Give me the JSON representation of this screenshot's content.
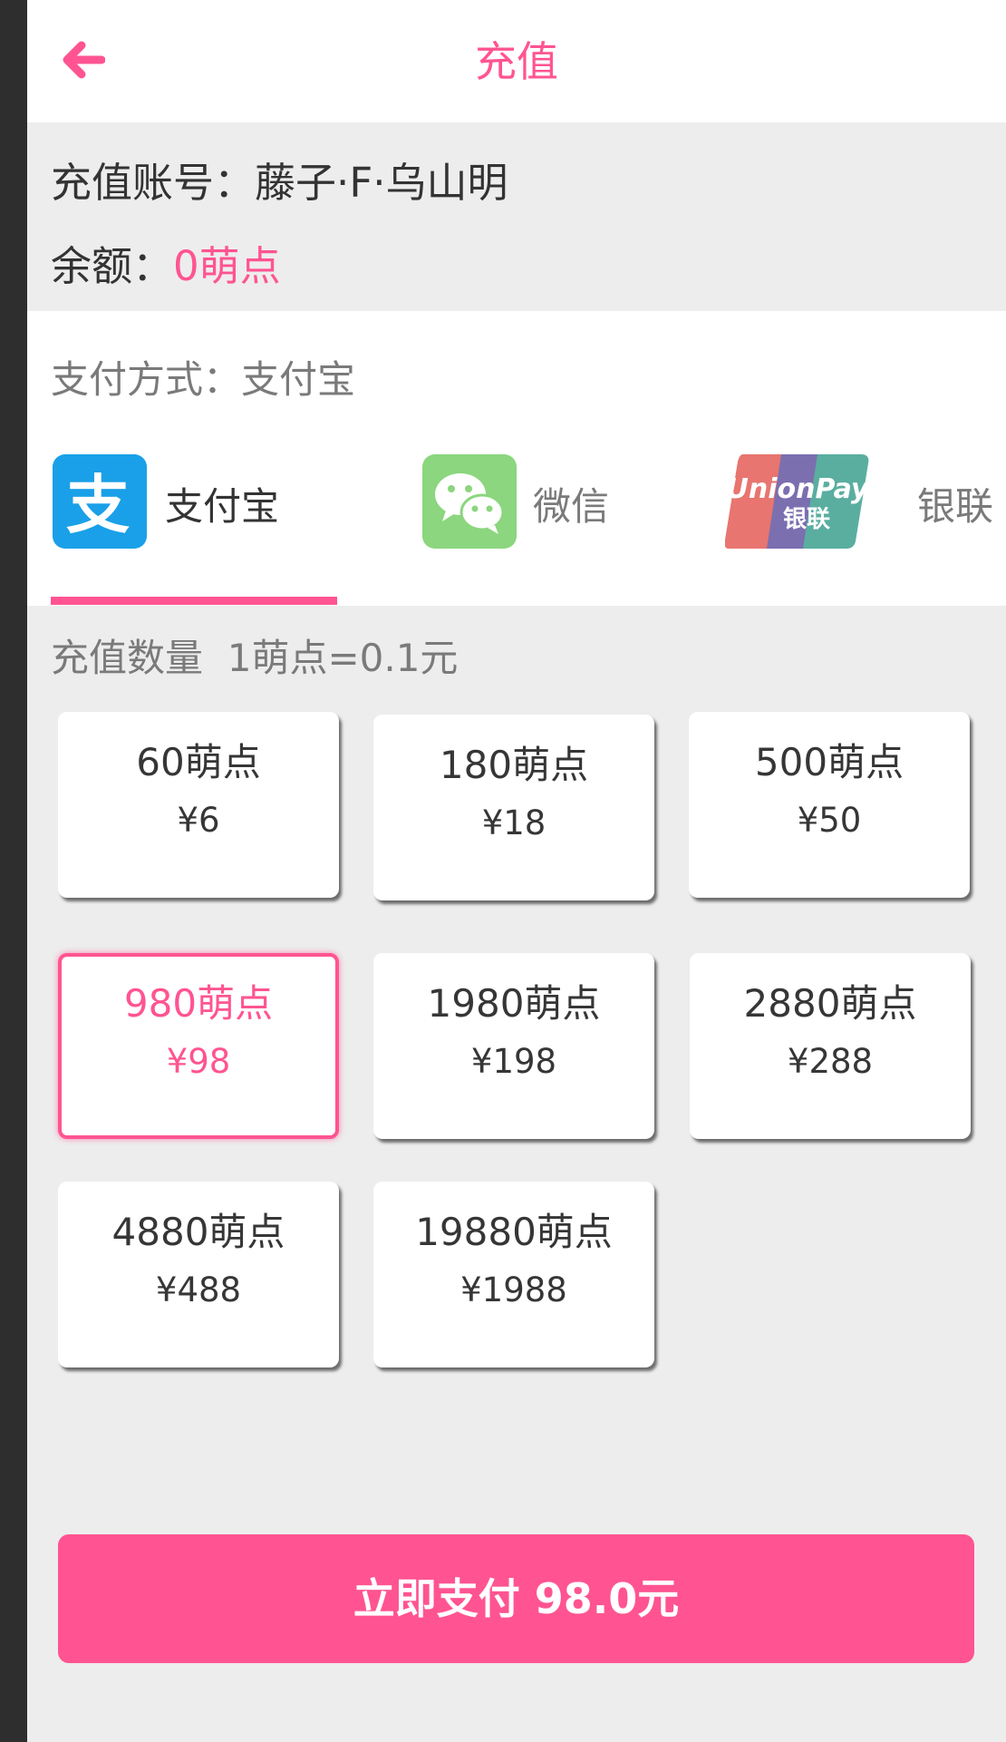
{
  "header": {
    "title": "充值",
    "back_icon": "arrow-left-icon",
    "accent_color": "#ff5491"
  },
  "account": {
    "label": "充值账号：",
    "name": "藤子·F·乌山明",
    "balance_label": "余额：",
    "balance_value": "0萌点"
  },
  "payment": {
    "label": "支付方式：",
    "selected": "支付宝",
    "options": [
      {
        "icon": "alipay-icon",
        "label": "支付宝"
      },
      {
        "icon": "wechat-icon",
        "label": "微信"
      },
      {
        "icon": "unionpay-icon",
        "label": "银联"
      }
    ]
  },
  "recharge": {
    "label": "充值数量",
    "rate": "1萌点=0.1元",
    "packages": [
      {
        "points": "60萌点",
        "price": "¥6"
      },
      {
        "points": "180萌点",
        "price": "¥18"
      },
      {
        "points": "500萌点",
        "price": "¥50"
      },
      {
        "points": "980萌点",
        "price": "¥98",
        "selected": true
      },
      {
        "points": "1980萌点",
        "price": "¥198"
      },
      {
        "points": "2880萌点",
        "price": "¥288"
      },
      {
        "points": "4880萌点",
        "price": "¥488"
      },
      {
        "points": "19880萌点",
        "price": "¥1988"
      }
    ]
  },
  "pay_button": {
    "label": "立即支付 98.0元"
  },
  "colors": {
    "primary_text": "#333333",
    "secondary_text": "#7a7a7a",
    "card_text": "#363636",
    "accent": "#ff5491",
    "background": "#ededed"
  }
}
